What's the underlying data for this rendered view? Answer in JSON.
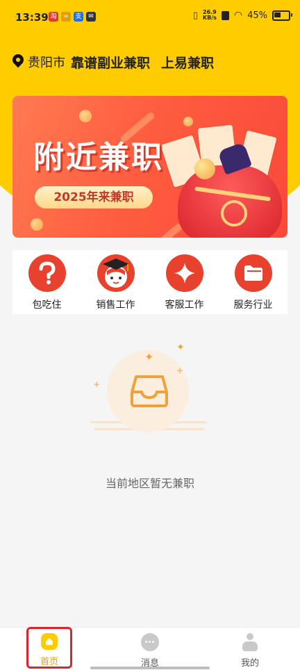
{
  "status_bar": {
    "time": "13:39",
    "net_speed_value": "26.9",
    "net_speed_unit": "KB/s",
    "battery": "45%"
  },
  "header": {
    "city": "贵阳市",
    "app_name": "靠谱副业兼职",
    "slogan": "上易兼职"
  },
  "banner": {
    "title": "附近兼职",
    "pill": "2025年来兼职"
  },
  "categories": [
    {
      "label": "包吃住",
      "icon": "question-icon"
    },
    {
      "label": "销售工作",
      "icon": "graduate-icon"
    },
    {
      "label": "客服工作",
      "icon": "sparkle-icon"
    },
    {
      "label": "服务行业",
      "icon": "folder-icon"
    }
  ],
  "empty_state": {
    "text": "当前地区暂无兼职"
  },
  "tabbar": {
    "items": [
      {
        "label": "首页",
        "active": true
      },
      {
        "label": "消息",
        "active": false
      },
      {
        "label": "我的",
        "active": false
      }
    ]
  },
  "colors": {
    "brand_yellow": "#ffcc00",
    "accent_red": "#e8412e",
    "active_tab": "#e8a300"
  }
}
